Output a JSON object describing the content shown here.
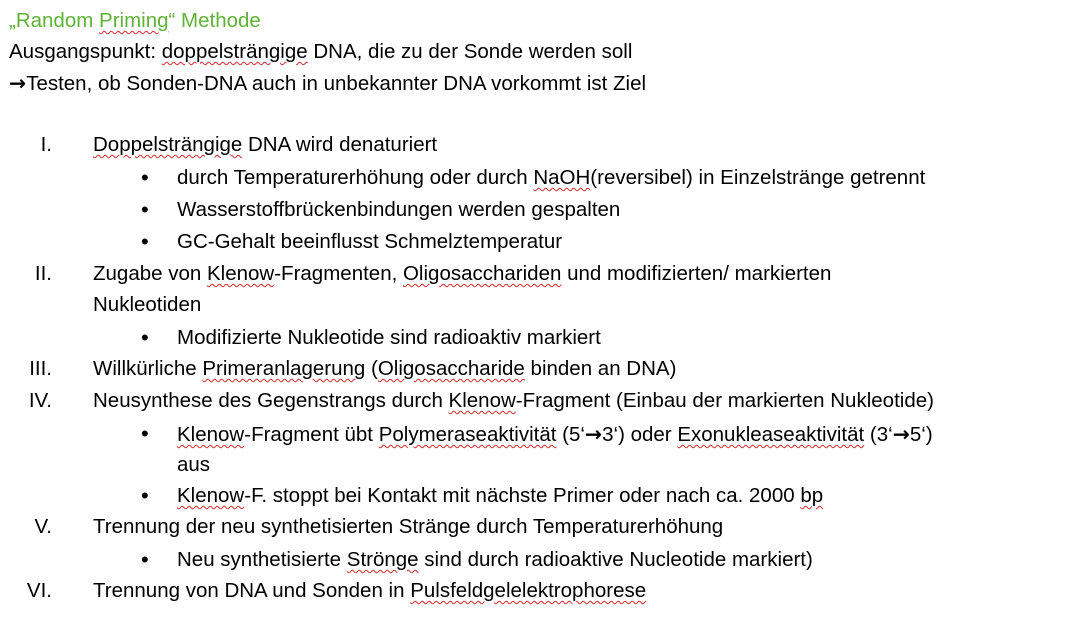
{
  "heading": {
    "title_a": "„Random ",
    "title_b": "Priming",
    "title_c": "“ Methode"
  },
  "intro": {
    "line1_a": "Ausgangspunkt: ",
    "line1_b": "doppelsträngige",
    "line1_c": " DNA, die zu der Sonde werden soll",
    "line2_arrow": "→",
    "line2_text": "Testen, ob Sonden-DNA auch in unbekannter DNA vorkommt ist Ziel"
  },
  "bullet_glyph": "•",
  "steps": [
    {
      "num": "I.",
      "a": "Doppelsträngige",
      "b": " DNA wird denaturiert",
      "bullets": [
        {
          "a": "durch Temperaturerhöhung oder durch ",
          "b": "NaOH",
          "c": "(reversibel) in Einzelstränge getrennt"
        },
        {
          "a": "Wasserstoffbrückenbindungen werden gespalten"
        },
        {
          "a": "GC-Gehalt beeinflusst Schmelztemperatur"
        }
      ]
    },
    {
      "num": "II.",
      "a": "Zugabe von ",
      "b": "Klenow",
      "c": "-Fragmenten, ",
      "d": "Oligosacchariden",
      "e": " und modifizierten/ markierten",
      "cont": "Nukleotiden",
      "bullets": [
        {
          "a": "Modifizierte Nukleotide sind radioaktiv markiert"
        }
      ]
    },
    {
      "num": "III.",
      "a": "Willkürliche ",
      "b": "Primeranlagerung",
      "c": " (",
      "d": "Oligosaccharide",
      "e": " binden an DNA)"
    },
    {
      "num": "IV.",
      "a": "Neusynthese des Gegenstrangs durch ",
      "b": "Klenow",
      "c": "-Fragment (Einbau der markierten Nukleotide)",
      "bullets": [
        {
          "a": "Klenow",
          "b": "-Fragment übt ",
          "c": "Polymeraseaktivität",
          "d": " (5‘",
          "e": "→",
          "f": "3‘) oder ",
          "g": "Exonukleaseaktivität",
          "h": " (3‘",
          "i": "→",
          "j": "5‘)",
          "cont": "aus"
        },
        {
          "a": "Klenow",
          "b": "-F. stoppt bei Kontakt mit nächste Primer oder nach ca. 2000 ",
          "c": "bp"
        }
      ]
    },
    {
      "num": "V.",
      "a": "Trennung der neu synthetisierten Stränge durch Temperaturerhöhung",
      "bullets": [
        {
          "a": "Neu synthetisierte ",
          "b": "Strönge",
          "c": " sind durch radioaktive Nucleotide markiert)"
        }
      ]
    },
    {
      "num": "VI.",
      "a": "Trennung von DNA und Sonden in ",
      "b": "Pulsfeldgelelektrophorese"
    }
  ]
}
